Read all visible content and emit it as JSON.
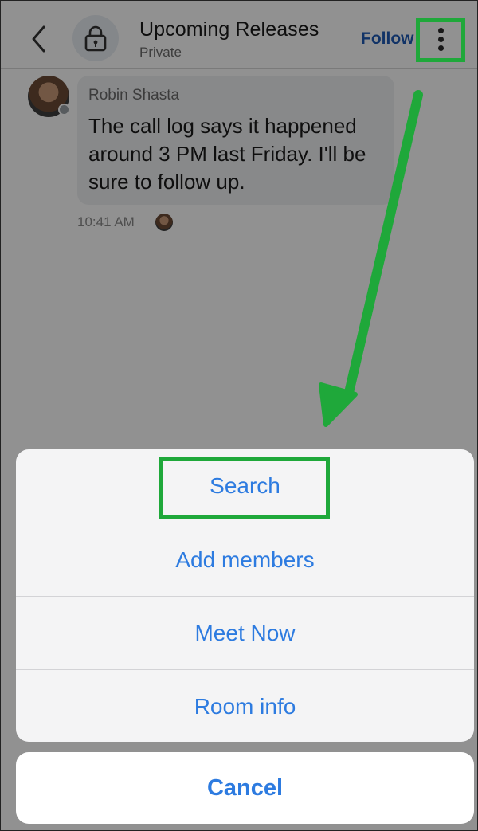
{
  "header": {
    "title": "Upcoming Releases",
    "subtitle": "Private",
    "follow_label": "Follow"
  },
  "message": {
    "sender": "Robin Shasta",
    "text": "The call log says it happened around 3 PM last Friday. I'll be sure to follow up.",
    "time": "10:41 AM"
  },
  "action_sheet": {
    "items": [
      {
        "label": "Search"
      },
      {
        "label": "Add members"
      },
      {
        "label": "Meet Now"
      },
      {
        "label": "Room info"
      }
    ],
    "cancel_label": "Cancel"
  },
  "colors": {
    "accent": "#2d7be0",
    "follow": "#1f5bb5",
    "highlight": "#1fa83a",
    "overlay": "rgba(0,0,0,0.43)"
  },
  "icons": [
    "back-chevron-icon",
    "lock-icon",
    "more-vertical-icon"
  ]
}
